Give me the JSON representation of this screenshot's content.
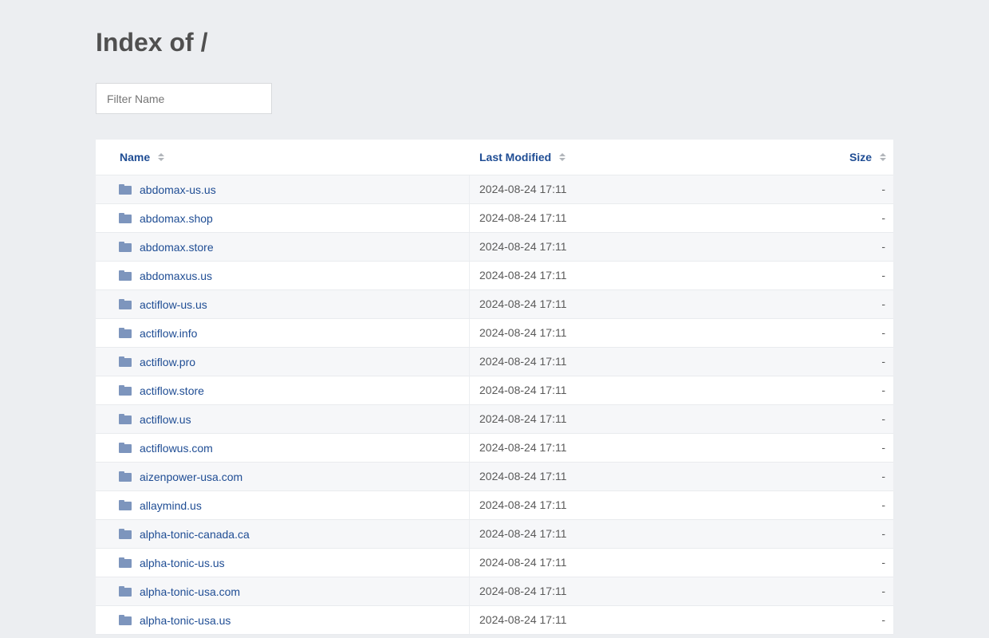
{
  "page": {
    "title": "Index of /",
    "filter_placeholder": "Filter Name"
  },
  "table": {
    "headers": {
      "name": "Name",
      "modified": "Last Modified",
      "size": "Size"
    },
    "rows": [
      {
        "name": "abdomax-us.us",
        "modified": "2024-08-24 17:11",
        "size": "-",
        "type": "folder-icon"
      },
      {
        "name": "abdomax.shop",
        "modified": "2024-08-24 17:11",
        "size": "-",
        "type": "folder-icon"
      },
      {
        "name": "abdomax.store",
        "modified": "2024-08-24 17:11",
        "size": "-",
        "type": "folder-icon"
      },
      {
        "name": "abdomaxus.us",
        "modified": "2024-08-24 17:11",
        "size": "-",
        "type": "folder-icon"
      },
      {
        "name": "actiflow-us.us",
        "modified": "2024-08-24 17:11",
        "size": "-",
        "type": "folder-icon"
      },
      {
        "name": "actiflow.info",
        "modified": "2024-08-24 17:11",
        "size": "-",
        "type": "folder-icon"
      },
      {
        "name": "actiflow.pro",
        "modified": "2024-08-24 17:11",
        "size": "-",
        "type": "folder-icon"
      },
      {
        "name": "actiflow.store",
        "modified": "2024-08-24 17:11",
        "size": "-",
        "type": "folder-icon"
      },
      {
        "name": "actiflow.us",
        "modified": "2024-08-24 17:11",
        "size": "-",
        "type": "folder-icon"
      },
      {
        "name": "actiflowus.com",
        "modified": "2024-08-24 17:11",
        "size": "-",
        "type": "folder-icon"
      },
      {
        "name": "aizenpower-usa.com",
        "modified": "2024-08-24 17:11",
        "size": "-",
        "type": "folder-icon"
      },
      {
        "name": "allaymind.us",
        "modified": "2024-08-24 17:11",
        "size": "-",
        "type": "folder-icon"
      },
      {
        "name": "alpha-tonic-canada.ca",
        "modified": "2024-08-24 17:11",
        "size": "-",
        "type": "folder-icon"
      },
      {
        "name": "alpha-tonic-us.us",
        "modified": "2024-08-24 17:11",
        "size": "-",
        "type": "folder-icon"
      },
      {
        "name": "alpha-tonic-usa.com",
        "modified": "2024-08-24 17:11",
        "size": "-",
        "type": "folder-icon"
      },
      {
        "name": "alpha-tonic-usa.us",
        "modified": "2024-08-24 17:11",
        "size": "-",
        "type": "folder-icon"
      }
    ]
  },
  "colors": {
    "background": "#eceef1",
    "link": "#1f4d94",
    "folder_icon": "#7d95bd",
    "row_alt": "#f6f7f9"
  }
}
